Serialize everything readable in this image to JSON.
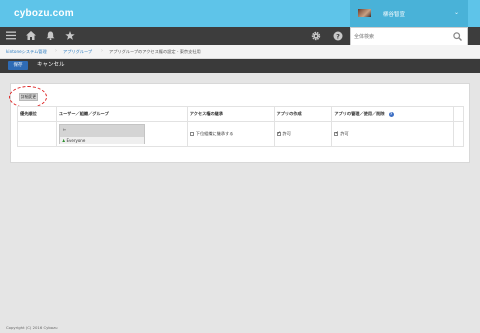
{
  "app": {
    "brand": "cybozu.com",
    "user_name": "柳谷智宣"
  },
  "search": {
    "placeholder": "全体検索"
  },
  "breadcrumb": [
    "kintoneシステム管理",
    "アプリグループ",
    "アプリグループのアクセス権の設定 - 東京支社用"
  ],
  "actions": {
    "save_label": "保存",
    "cancel_label": "キャンセル"
  },
  "panel": {
    "collapse_label": "詳細変更"
  },
  "table": {
    "headers": [
      "優先順位",
      "ユーザー／組織／グループ",
      "アクセス権の継承",
      "アプリの作成",
      "アプリの管理／使用／削除"
    ],
    "rows": [
      {
        "entity": "Everyone",
        "inherit_label": "下位組織に継承する",
        "inherit_checked": false,
        "create_label": "許可",
        "create_checked": true,
        "manage_label": "許可",
        "manage_checked": true
      }
    ]
  },
  "footer": {
    "copyright": "Copyright (C) 2016 Cybozu"
  },
  "icons": [
    "menu-icon",
    "home-icon",
    "bell-icon",
    "star-icon",
    "gear-icon",
    "help-icon",
    "search-icon",
    "chevron-down-icon",
    "lock-icon",
    "people-icon",
    "info-icon"
  ],
  "colors": {
    "brand_bar": "#5ec4e9",
    "toolbar": "#3d3d3d",
    "save_button": "#2e6bb5",
    "highlight": "#dd2222"
  }
}
